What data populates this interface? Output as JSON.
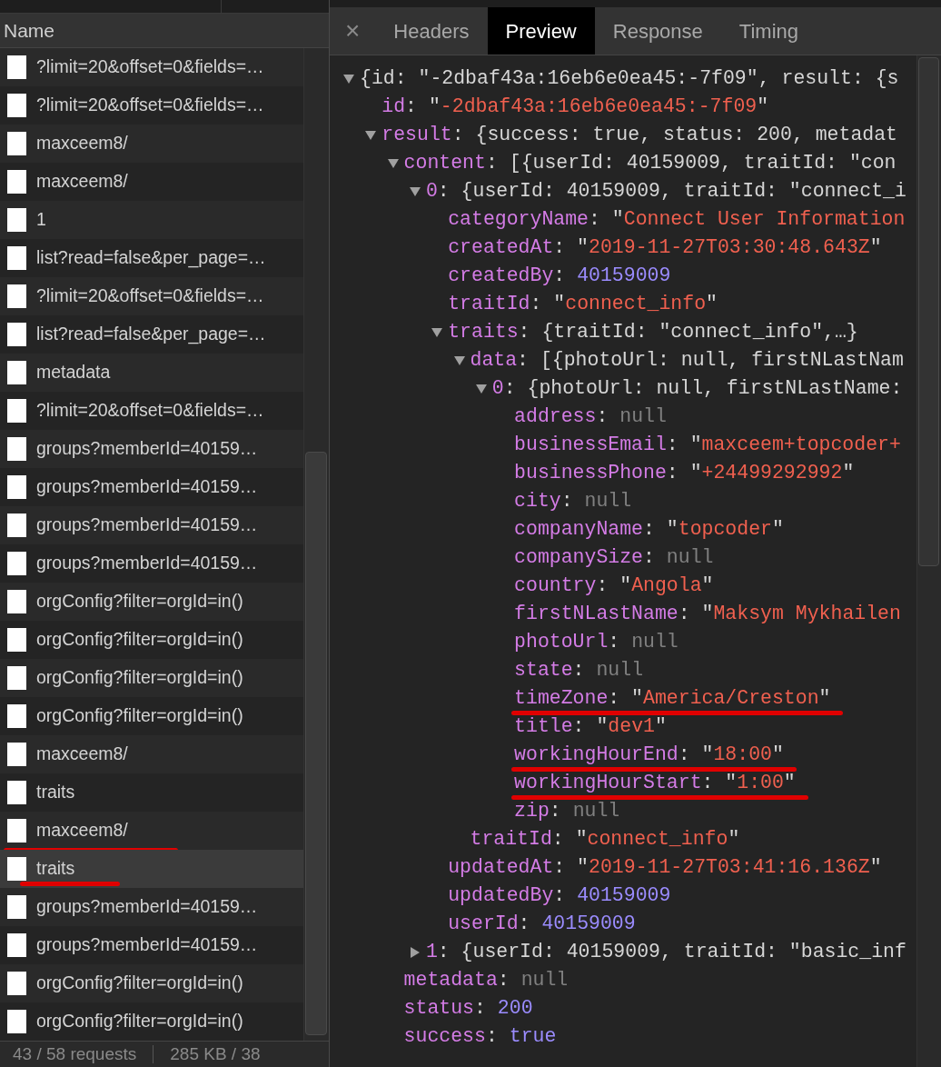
{
  "requests": {
    "column": "Name",
    "rows": [
      {
        "name": "?limit=20&offset=0&fields=…",
        "selected": false,
        "underlined": false
      },
      {
        "name": "?limit=20&offset=0&fields=…",
        "selected": false,
        "underlined": false
      },
      {
        "name": "maxceem8/",
        "selected": false,
        "underlined": false
      },
      {
        "name": "maxceem8/",
        "selected": false,
        "underlined": false
      },
      {
        "name": "1",
        "selected": false,
        "underlined": false
      },
      {
        "name": "list?read=false&per_page=…",
        "selected": false,
        "underlined": false
      },
      {
        "name": "?limit=20&offset=0&fields=…",
        "selected": false,
        "underlined": false
      },
      {
        "name": "list?read=false&per_page=…",
        "selected": false,
        "underlined": false
      },
      {
        "name": "metadata",
        "selected": false,
        "underlined": false
      },
      {
        "name": "?limit=20&offset=0&fields=…",
        "selected": false,
        "underlined": false
      },
      {
        "name": "groups?memberId=40159…",
        "selected": false,
        "underlined": false
      },
      {
        "name": "groups?memberId=40159…",
        "selected": false,
        "underlined": false
      },
      {
        "name": "groups?memberId=40159…",
        "selected": false,
        "underlined": false
      },
      {
        "name": "groups?memberId=40159…",
        "selected": false,
        "underlined": false
      },
      {
        "name": "orgConfig?filter=orgId=in()",
        "selected": false,
        "underlined": false
      },
      {
        "name": "orgConfig?filter=orgId=in()",
        "selected": false,
        "underlined": false
      },
      {
        "name": "orgConfig?filter=orgId=in()",
        "selected": false,
        "underlined": false
      },
      {
        "name": "orgConfig?filter=orgId=in()",
        "selected": false,
        "underlined": false
      },
      {
        "name": "maxceem8/",
        "selected": false,
        "underlined": false
      },
      {
        "name": "traits",
        "selected": false,
        "underlined": false
      },
      {
        "name": "maxceem8/",
        "selected": false,
        "underlined": true
      },
      {
        "name": "traits",
        "selected": true,
        "underlined": true
      },
      {
        "name": "groups?memberId=40159…",
        "selected": false,
        "underlined": false
      },
      {
        "name": "groups?memberId=40159…",
        "selected": false,
        "underlined": false
      },
      {
        "name": "orgConfig?filter=orgId=in()",
        "selected": false,
        "underlined": false
      },
      {
        "name": "orgConfig?filter=orgId=in()",
        "selected": false,
        "underlined": false
      }
    ],
    "status_bar": [
      "43 / 58 requests",
      "285 KB / 38"
    ]
  },
  "detail": {
    "close": "×",
    "tabs": [
      {
        "label": "Headers",
        "selected": false
      },
      {
        "label": "Preview",
        "selected": true
      },
      {
        "label": "Response",
        "selected": false
      },
      {
        "label": "Timing",
        "selected": false
      }
    ],
    "preview": {
      "kind": "object",
      "expanded": true,
      "underlined": false,
      "parts": [
        {
          "kind": "plain",
          "text": "{id: \"-2dbaf43a:16eb6e0ea45:-7f09\", result: {s"
        }
      ],
      "children": [
        {
          "kind": "leaf",
          "underlined": false,
          "parts": [
            {
              "kind": "key",
              "text": "id"
            },
            {
              "kind": "plain",
              "text": ": \""
            },
            {
              "kind": "string",
              "text": "-2dbaf43a:16eb6e0ea45:-7f09"
            },
            {
              "kind": "plain",
              "text": "\""
            }
          ]
        },
        {
          "kind": "object",
          "expanded": true,
          "underlined": false,
          "parts": [
            {
              "kind": "key",
              "text": "result"
            },
            {
              "kind": "plain",
              "text": ": {success: true, status: 200, metadat"
            }
          ],
          "children": [
            {
              "kind": "object",
              "expanded": true,
              "underlined": false,
              "parts": [
                {
                  "kind": "key",
                  "text": "content"
                },
                {
                  "kind": "plain",
                  "text": ": [{userId: 40159009, traitId: \"con"
                }
              ],
              "children": [
                {
                  "kind": "object",
                  "expanded": true,
                  "underlined": false,
                  "parts": [
                    {
                      "kind": "key",
                      "text": "0"
                    },
                    {
                      "kind": "plain",
                      "text": ": {userId: 40159009, traitId: \"connect_i"
                    }
                  ],
                  "children": [
                    {
                      "kind": "leaf",
                      "underlined": false,
                      "parts": [
                        {
                          "kind": "key",
                          "text": "categoryName"
                        },
                        {
                          "kind": "plain",
                          "text": ": \""
                        },
                        {
                          "kind": "string",
                          "text": "Connect User Information"
                        }
                      ]
                    },
                    {
                      "kind": "leaf",
                      "underlined": false,
                      "parts": [
                        {
                          "kind": "key",
                          "text": "createdAt"
                        },
                        {
                          "kind": "plain",
                          "text": ": \""
                        },
                        {
                          "kind": "string",
                          "text": "2019-11-27T03:30:48.643Z"
                        },
                        {
                          "kind": "plain",
                          "text": "\""
                        }
                      ]
                    },
                    {
                      "kind": "leaf",
                      "underlined": false,
                      "parts": [
                        {
                          "kind": "key",
                          "text": "createdBy"
                        },
                        {
                          "kind": "plain",
                          "text": ": "
                        },
                        {
                          "kind": "number",
                          "text": "40159009"
                        }
                      ]
                    },
                    {
                      "kind": "leaf",
                      "underlined": false,
                      "parts": [
                        {
                          "kind": "key",
                          "text": "traitId"
                        },
                        {
                          "kind": "plain",
                          "text": ": \""
                        },
                        {
                          "kind": "string",
                          "text": "connect_info"
                        },
                        {
                          "kind": "plain",
                          "text": "\""
                        }
                      ]
                    },
                    {
                      "kind": "object",
                      "expanded": true,
                      "underlined": false,
                      "parts": [
                        {
                          "kind": "key",
                          "text": "traits"
                        },
                        {
                          "kind": "plain",
                          "text": ": {traitId: \"connect_info\",…}"
                        }
                      ],
                      "children": [
                        {
                          "kind": "object",
                          "expanded": true,
                          "underlined": false,
                          "parts": [
                            {
                              "kind": "key",
                              "text": "data"
                            },
                            {
                              "kind": "plain",
                              "text": ": [{photoUrl: null, firstNLastNam"
                            }
                          ],
                          "children": [
                            {
                              "kind": "object",
                              "expanded": true,
                              "underlined": false,
                              "parts": [
                                {
                                  "kind": "key",
                                  "text": "0"
                                },
                                {
                                  "kind": "plain",
                                  "text": ": {photoUrl: null, firstNLastName:"
                                }
                              ],
                              "children": [
                                {
                                  "kind": "leaf",
                                  "underlined": false,
                                  "parts": [
                                    {
                                      "kind": "key",
                                      "text": "address"
                                    },
                                    {
                                      "kind": "plain",
                                      "text": ": "
                                    },
                                    {
                                      "kind": "null",
                                      "text": "null"
                                    }
                                  ]
                                },
                                {
                                  "kind": "leaf",
                                  "underlined": false,
                                  "parts": [
                                    {
                                      "kind": "key",
                                      "text": "businessEmail"
                                    },
                                    {
                                      "kind": "plain",
                                      "text": ": \""
                                    },
                                    {
                                      "kind": "string",
                                      "text": "maxceem+topcoder+"
                                    }
                                  ]
                                },
                                {
                                  "kind": "leaf",
                                  "underlined": false,
                                  "parts": [
                                    {
                                      "kind": "key",
                                      "text": "businessPhone"
                                    },
                                    {
                                      "kind": "plain",
                                      "text": ": \""
                                    },
                                    {
                                      "kind": "string",
                                      "text": "+24499292992"
                                    },
                                    {
                                      "kind": "plain",
                                      "text": "\""
                                    }
                                  ]
                                },
                                {
                                  "kind": "leaf",
                                  "underlined": false,
                                  "parts": [
                                    {
                                      "kind": "key",
                                      "text": "city"
                                    },
                                    {
                                      "kind": "plain",
                                      "text": ": "
                                    },
                                    {
                                      "kind": "null",
                                      "text": "null"
                                    }
                                  ]
                                },
                                {
                                  "kind": "leaf",
                                  "underlined": false,
                                  "parts": [
                                    {
                                      "kind": "key",
                                      "text": "companyName"
                                    },
                                    {
                                      "kind": "plain",
                                      "text": ": \""
                                    },
                                    {
                                      "kind": "string",
                                      "text": "topcoder"
                                    },
                                    {
                                      "kind": "plain",
                                      "text": "\""
                                    }
                                  ]
                                },
                                {
                                  "kind": "leaf",
                                  "underlined": false,
                                  "parts": [
                                    {
                                      "kind": "key",
                                      "text": "companySize"
                                    },
                                    {
                                      "kind": "plain",
                                      "text": ": "
                                    },
                                    {
                                      "kind": "null",
                                      "text": "null"
                                    }
                                  ]
                                },
                                {
                                  "kind": "leaf",
                                  "underlined": false,
                                  "parts": [
                                    {
                                      "kind": "key",
                                      "text": "country"
                                    },
                                    {
                                      "kind": "plain",
                                      "text": ": \""
                                    },
                                    {
                                      "kind": "string",
                                      "text": "Angola"
                                    },
                                    {
                                      "kind": "plain",
                                      "text": "\""
                                    }
                                  ]
                                },
                                {
                                  "kind": "leaf",
                                  "underlined": false,
                                  "parts": [
                                    {
                                      "kind": "key",
                                      "text": "firstNLastName"
                                    },
                                    {
                                      "kind": "plain",
                                      "text": ": \""
                                    },
                                    {
                                      "kind": "string",
                                      "text": "Maksym Mykhailen"
                                    }
                                  ]
                                },
                                {
                                  "kind": "leaf",
                                  "underlined": false,
                                  "parts": [
                                    {
                                      "kind": "key",
                                      "text": "photoUrl"
                                    },
                                    {
                                      "kind": "plain",
                                      "text": ": "
                                    },
                                    {
                                      "kind": "null",
                                      "text": "null"
                                    }
                                  ]
                                },
                                {
                                  "kind": "leaf",
                                  "underlined": false,
                                  "parts": [
                                    {
                                      "kind": "key",
                                      "text": "state"
                                    },
                                    {
                                      "kind": "plain",
                                      "text": ": "
                                    },
                                    {
                                      "kind": "null",
                                      "text": "null"
                                    }
                                  ]
                                },
                                {
                                  "kind": "leaf",
                                  "underlined": true,
                                  "parts": [
                                    {
                                      "kind": "key",
                                      "text": "timeZone"
                                    },
                                    {
                                      "kind": "plain",
                                      "text": ": \""
                                    },
                                    {
                                      "kind": "string",
                                      "text": "America/Creston"
                                    },
                                    {
                                      "kind": "plain",
                                      "text": "\""
                                    }
                                  ]
                                },
                                {
                                  "kind": "leaf",
                                  "underlined": false,
                                  "parts": [
                                    {
                                      "kind": "key",
                                      "text": "title"
                                    },
                                    {
                                      "kind": "plain",
                                      "text": ": \""
                                    },
                                    {
                                      "kind": "string",
                                      "text": "dev1"
                                    },
                                    {
                                      "kind": "plain",
                                      "text": "\""
                                    }
                                  ]
                                },
                                {
                                  "kind": "leaf",
                                  "underlined": true,
                                  "parts": [
                                    {
                                      "kind": "key",
                                      "text": "workingHourEnd"
                                    },
                                    {
                                      "kind": "plain",
                                      "text": ": \""
                                    },
                                    {
                                      "kind": "string",
                                      "text": "18:00"
                                    },
                                    {
                                      "kind": "plain",
                                      "text": "\""
                                    }
                                  ]
                                },
                                {
                                  "kind": "leaf",
                                  "underlined": true,
                                  "parts": [
                                    {
                                      "kind": "key",
                                      "text": "workingHourStart"
                                    },
                                    {
                                      "kind": "plain",
                                      "text": ": \""
                                    },
                                    {
                                      "kind": "string",
                                      "text": "1:00"
                                    },
                                    {
                                      "kind": "plain",
                                      "text": "\""
                                    }
                                  ]
                                },
                                {
                                  "kind": "leaf",
                                  "underlined": false,
                                  "parts": [
                                    {
                                      "kind": "key",
                                      "text": "zip"
                                    },
                                    {
                                      "kind": "plain",
                                      "text": ": "
                                    },
                                    {
                                      "kind": "null",
                                      "text": "null"
                                    }
                                  ]
                                }
                              ]
                            }
                          ]
                        },
                        {
                          "kind": "leaf",
                          "underlined": false,
                          "parts": [
                            {
                              "kind": "key",
                              "text": "traitId"
                            },
                            {
                              "kind": "plain",
                              "text": ": \""
                            },
                            {
                              "kind": "string",
                              "text": "connect_info"
                            },
                            {
                              "kind": "plain",
                              "text": "\""
                            }
                          ]
                        }
                      ]
                    },
                    {
                      "kind": "leaf",
                      "underlined": false,
                      "parts": [
                        {
                          "kind": "key",
                          "text": "updatedAt"
                        },
                        {
                          "kind": "plain",
                          "text": ": \""
                        },
                        {
                          "kind": "string",
                          "text": "2019-11-27T03:41:16.136Z"
                        },
                        {
                          "kind": "plain",
                          "text": "\""
                        }
                      ]
                    },
                    {
                      "kind": "leaf",
                      "underlined": false,
                      "parts": [
                        {
                          "kind": "key",
                          "text": "updatedBy"
                        },
                        {
                          "kind": "plain",
                          "text": ": "
                        },
                        {
                          "kind": "number",
                          "text": "40159009"
                        }
                      ]
                    },
                    {
                      "kind": "leaf",
                      "underlined": false,
                      "parts": [
                        {
                          "kind": "key",
                          "text": "userId"
                        },
                        {
                          "kind": "plain",
                          "text": ": "
                        },
                        {
                          "kind": "number",
                          "text": "40159009"
                        }
                      ]
                    }
                  ]
                },
                {
                  "kind": "object",
                  "expanded": false,
                  "underlined": false,
                  "parts": [
                    {
                      "kind": "key",
                      "text": "1"
                    },
                    {
                      "kind": "plain",
                      "text": ": {userId: 40159009, traitId: \"basic_inf"
                    }
                  ]
                }
              ]
            },
            {
              "kind": "leaf",
              "underlined": false,
              "parts": [
                {
                  "kind": "key",
                  "text": "metadata"
                },
                {
                  "kind": "plain",
                  "text": ": "
                },
                {
                  "kind": "null",
                  "text": "null"
                }
              ]
            },
            {
              "kind": "leaf",
              "underlined": false,
              "parts": [
                {
                  "kind": "key",
                  "text": "status"
                },
                {
                  "kind": "plain",
                  "text": ": "
                },
                {
                  "kind": "number",
                  "text": "200"
                }
              ]
            },
            {
              "kind": "leaf",
              "underlined": false,
              "parts": [
                {
                  "kind": "key",
                  "text": "success"
                },
                {
                  "kind": "plain",
                  "text": ": "
                },
                {
                  "kind": "number",
                  "text": "true"
                }
              ]
            }
          ]
        }
      ]
    }
  }
}
